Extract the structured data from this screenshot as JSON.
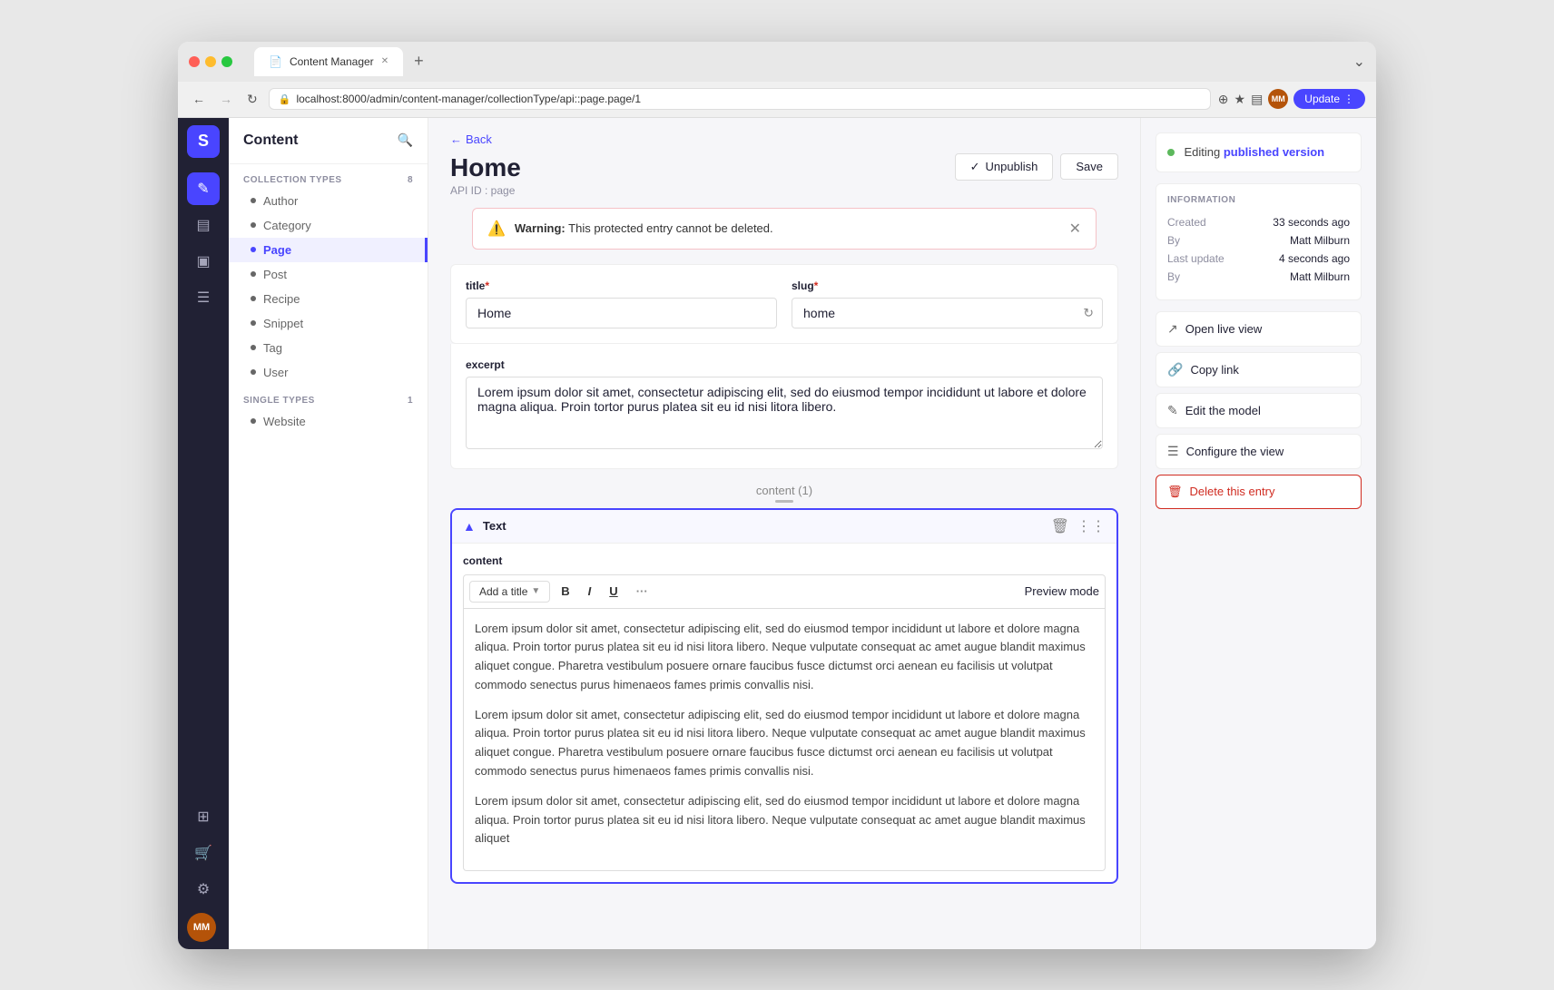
{
  "window": {
    "tab_title": "Content Manager",
    "url": "localhost:8000/admin/content-manager/collectionType/api::page.page/1",
    "update_btn": "Update"
  },
  "sidebar": {
    "title": "Content",
    "collection_types_label": "COLLECTION TYPES",
    "collection_types_count": "8",
    "single_types_label": "SINGLE TYPES",
    "single_types_count": "1",
    "collection_items": [
      {
        "label": "Author"
      },
      {
        "label": "Category"
      },
      {
        "label": "Page",
        "active": true
      },
      {
        "label": "Post"
      },
      {
        "label": "Recipe"
      },
      {
        "label": "Snippet"
      },
      {
        "label": "Tag"
      },
      {
        "label": "User"
      }
    ],
    "single_items": [
      {
        "label": "Website"
      }
    ]
  },
  "header": {
    "back_label": "Back",
    "page_title": "Home",
    "api_id_label": "API ID : page",
    "unpublish_btn": "Unpublish",
    "save_btn": "Save"
  },
  "warning": {
    "text_strong": "Warning:",
    "text": "This protected entry cannot be deleted."
  },
  "form": {
    "title_label": "title",
    "title_value": "Home",
    "slug_label": "slug",
    "slug_value": "home",
    "excerpt_label": "excerpt",
    "excerpt_value": "Lorem ipsum dolor sit amet, consectetur adipiscing elit, sed do eiusmod tempor incididunt ut labore et dolore magna aliqua. Proin tortor purus platea sit eu id nisi litora libero."
  },
  "content_block": {
    "label": "content (1)",
    "type": "Text",
    "content_label": "content",
    "add_title_btn": "Add a title",
    "preview_mode_btn": "Preview mode",
    "bold_btn": "B",
    "italic_btn": "I",
    "underline_btn": "U",
    "more_btn": "···",
    "paragraphs": [
      "Lorem ipsum dolor sit amet, consectetur adipiscing elit, sed do eiusmod tempor incididunt ut labore et dolore magna aliqua. Proin tortor purus platea sit eu id nisi litora libero. Neque vulputate consequat ac amet augue blandit maximus aliquet congue. Pharetra vestibulum posuere ornare faucibus fusce dictumst orci aenean eu facilisis ut volutpat commodo senectus purus himenaeos fames primis convallis nisi.",
      "Lorem ipsum dolor sit amet, consectetur adipiscing elit, sed do eiusmod tempor incididunt ut labore et dolore magna aliqua. Proin tortor purus platea sit eu id nisi litora libero. Neque vulputate consequat ac amet augue blandit maximus aliquet congue. Pharetra vestibulum posuere ornare faucibus fusce dictumst orci aenean eu facilisis ut volutpat commodo senectus purus himenaeos fames primis convallis nisi.",
      "Lorem ipsum dolor sit amet, consectetur adipiscing elit, sed do eiusmod tempor incididunt ut labore et dolore magna aliqua. Proin tortor purus platea sit eu id nisi litora libero. Neque vulputate consequat ac amet augue blandit maximus aliquet"
    ]
  },
  "right_panel": {
    "status_text": "Editing",
    "status_highlight": "published version",
    "info_title": "INFORMATION",
    "created_label": "Created",
    "created_value": "33 seconds ago",
    "by_label": "By",
    "created_by": "Matt Milburn",
    "last_update_label": "Last update",
    "last_update_value": "4 seconds ago",
    "updated_by_label": "By",
    "updated_by": "Matt Milburn",
    "open_live_view": "Open live view",
    "copy_link": "Copy link",
    "edit_model": "Edit the model",
    "configure_view": "Configure the view",
    "delete_entry": "Delete this entry"
  },
  "user": {
    "initials": "MM"
  }
}
